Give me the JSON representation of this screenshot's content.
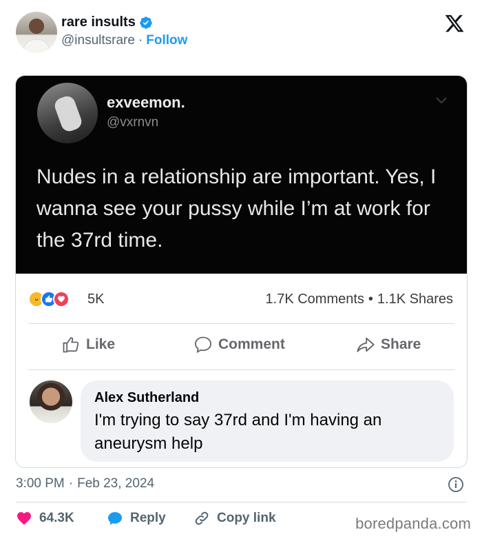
{
  "tweet": {
    "display_name": "rare insults",
    "handle": "@insultsrare",
    "separator": "·",
    "follow_label": "Follow",
    "timestamp_time": "3:00 PM",
    "timestamp_date": "Feb 23, 2024",
    "timestamp_sep": "·"
  },
  "embedded_post": {
    "author": "exveemon.",
    "handle": "@vxrnvn",
    "text": "Nudes in a relationship are important. Yes, I wanna see your pussy while I’m at work for the 37rd time.",
    "reaction_count": "5K",
    "comments": "1.7K Comments",
    "stats_sep": "•",
    "shares": "1.1K Shares",
    "actions": {
      "like": "Like",
      "comment": "Comment",
      "share": "Share"
    },
    "comment": {
      "author": "Alex Sutherland",
      "text": "I'm trying to say 37rd and I'm having an aneurysm help"
    }
  },
  "footer": {
    "likes": "64.3K",
    "reply": "Reply",
    "copy_link": "Copy link"
  },
  "watermark": "boredpanda.com",
  "colors": {
    "accent": "#1d9bf0",
    "like_heart": "#f91880",
    "reply_bubble": "#1d9bf0",
    "dark_post_bg": "#050505"
  },
  "icons": {
    "verified": "verified-badge-icon",
    "x": "x-logo-icon",
    "info": "info-icon",
    "heart": "heart-icon",
    "reply": "reply-bubble-icon",
    "link": "link-icon"
  }
}
